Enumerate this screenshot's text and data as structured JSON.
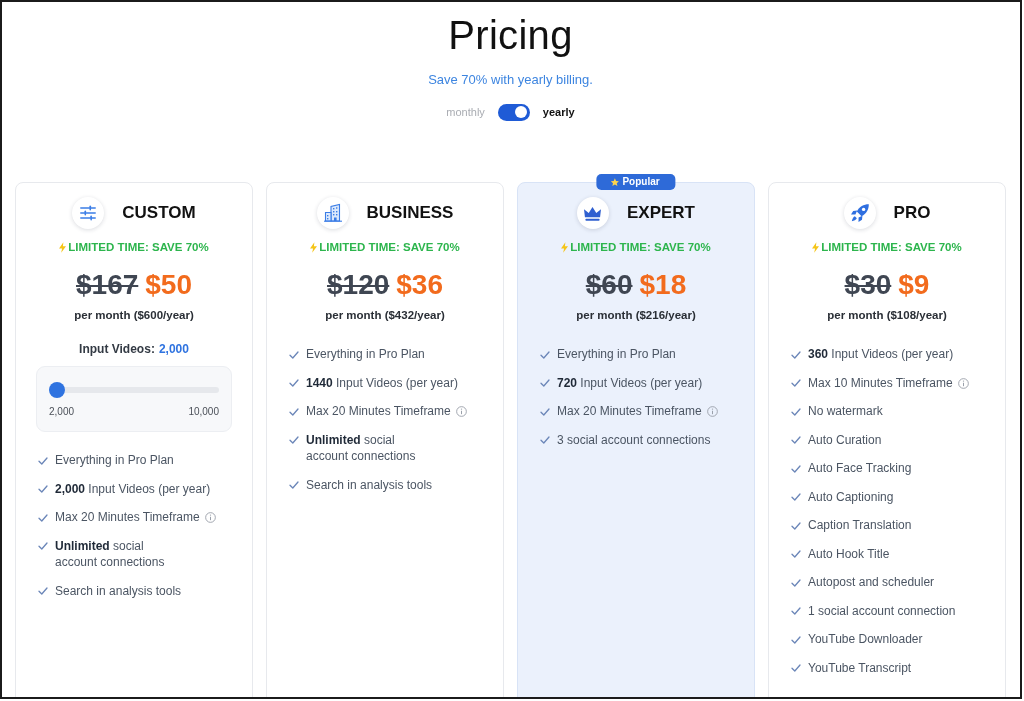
{
  "title": "Pricing",
  "subtitle": "Save 70% with yearly billing.",
  "billing_toggle": {
    "off_label": "monthly",
    "on_label": "yearly",
    "on": true
  },
  "plans": [
    {
      "name": "CUSTOM",
      "highlighted": false,
      "promo": "LIMITED TIME: SAVE 70%",
      "old_price": "$167",
      "price": "$50",
      "billing_note": "per month ($600/year)",
      "slider": {
        "label": "Input Videos:",
        "value": "2,000",
        "level": 0,
        "min_label": "2,000",
        "max_label": "10,000"
      },
      "features": [
        {
          "text": "Everything in Pro Plan",
          "info": false
        },
        {
          "text": "**2,000** Input Videos (per year)",
          "info": false
        },
        {
          "text": "Max 20 Minutes Timeframe",
          "info": true
        },
        {
          "text": "**Unlimited** social\naccount connections",
          "info": false
        },
        {
          "text": "Search in analysis tools",
          "info": false
        }
      ]
    },
    {
      "name": "BUSINESS",
      "highlighted": false,
      "promo": "LIMITED TIME: SAVE 70%",
      "old_price": "$120",
      "price": "$36",
      "billing_note": "per month ($432/year)",
      "features": [
        {
          "text": "Everything in Pro Plan",
          "info": false
        },
        {
          "text": "**1440** Input Videos (per year)",
          "info": false
        },
        {
          "text": "Max 20 Minutes Timeframe",
          "info": true
        },
        {
          "text": "**Unlimited** social\naccount connections",
          "info": false
        },
        {
          "text": "Search in analysis tools",
          "info": false
        }
      ]
    },
    {
      "name": "EXPERT",
      "highlighted": true,
      "badge": "Popular",
      "promo": "LIMITED TIME: SAVE 70%",
      "old_price": "$60",
      "price": "$18",
      "billing_note": "per month ($216/year)",
      "features": [
        {
          "text": "Everything in Pro Plan",
          "info": false
        },
        {
          "text": "**720** Input Videos (per year)",
          "info": false
        },
        {
          "text": "Max 20 Minutes Timeframe",
          "info": true
        },
        {
          "text": "3 social account connections",
          "info": false
        }
      ]
    },
    {
      "name": "PRO",
      "highlighted": false,
      "promo": "LIMITED TIME: SAVE 70%",
      "old_price": "$30",
      "price": "$9",
      "billing_note": "per month ($108/year)",
      "features": [
        {
          "text": "**360** Input Videos (per year)",
          "info": false
        },
        {
          "text": "Max 10 Minutes Timeframe",
          "info": true
        },
        {
          "text": "No watermark",
          "info": false
        },
        {
          "text": "Auto Curation",
          "info": false
        },
        {
          "text": "Auto Face Tracking",
          "info": false
        },
        {
          "text": "Auto Captioning",
          "info": false
        },
        {
          "text": "Caption Translation",
          "info": false
        },
        {
          "text": "Auto Hook Title",
          "info": false
        },
        {
          "text": "Autopost and scheduler",
          "info": false
        },
        {
          "text": "1 social account connection",
          "info": false
        },
        {
          "text": "YouTube Downloader",
          "info": false
        },
        {
          "text": "YouTube Transcript",
          "info": false
        }
      ]
    }
  ]
}
